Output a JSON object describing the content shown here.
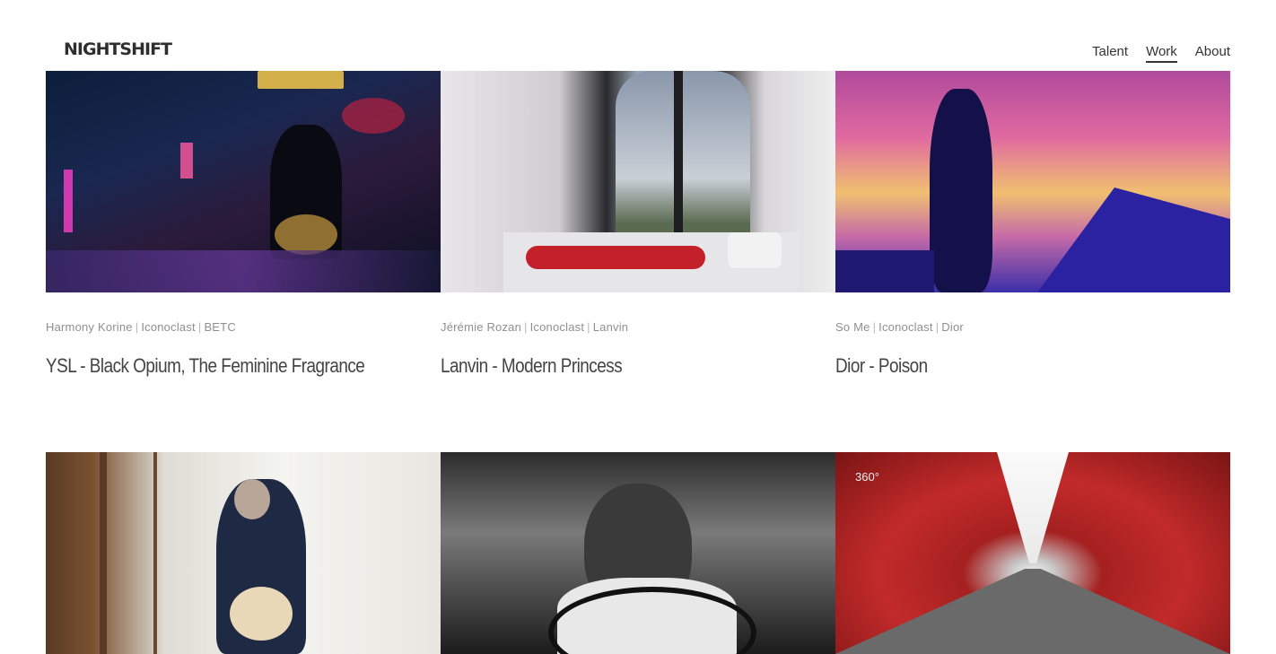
{
  "brand": {
    "logo": "NIGHTSHIFT"
  },
  "nav": {
    "items": [
      "Talent",
      "Work",
      "About"
    ],
    "active": "Work"
  },
  "projects": [
    {
      "director": "Harmony Korine",
      "agency": "Iconoclast",
      "client": "BETC",
      "title": "YSL - Black Opium, The Feminine Fragrance"
    },
    {
      "director": "Jérémie Rozan",
      "agency": "Iconoclast",
      "client": "Lanvin",
      "title": "Lanvin - Modern Princess"
    },
    {
      "director": "So Me",
      "agency": "Iconoclast",
      "client": "Dior",
      "title": "Dior - Poison"
    },
    {
      "badge": "360°"
    }
  ],
  "colors": {
    "text": "#333333",
    "credits": "#8f8f8f",
    "background": "#ffffff"
  }
}
